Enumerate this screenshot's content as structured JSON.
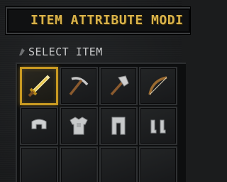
{
  "window": {
    "title": "ITEM ATTRIBUTE MODI"
  },
  "section": {
    "label": "SELECT ITEM"
  },
  "slots": [
    {
      "icon": "golden-sword-icon",
      "selected": true
    },
    {
      "icon": "pickaxe-icon",
      "selected": false
    },
    {
      "icon": "axe-icon",
      "selected": false
    },
    {
      "icon": "bow-icon",
      "selected": false
    },
    {
      "icon": "iron-helmet-icon",
      "selected": false
    },
    {
      "icon": "iron-chestplate-icon",
      "selected": false
    },
    {
      "icon": "iron-leggings-icon",
      "selected": false
    },
    {
      "icon": "iron-boots-icon",
      "selected": false
    },
    {
      "icon": "empty-slot",
      "selected": false
    },
    {
      "icon": "empty-slot",
      "selected": false
    },
    {
      "icon": "empty-slot",
      "selected": false
    },
    {
      "icon": "empty-slot",
      "selected": false
    }
  ],
  "colors": {
    "accent": "#d8b24a",
    "selection": "#c99a22",
    "label": "#c9cacb"
  }
}
